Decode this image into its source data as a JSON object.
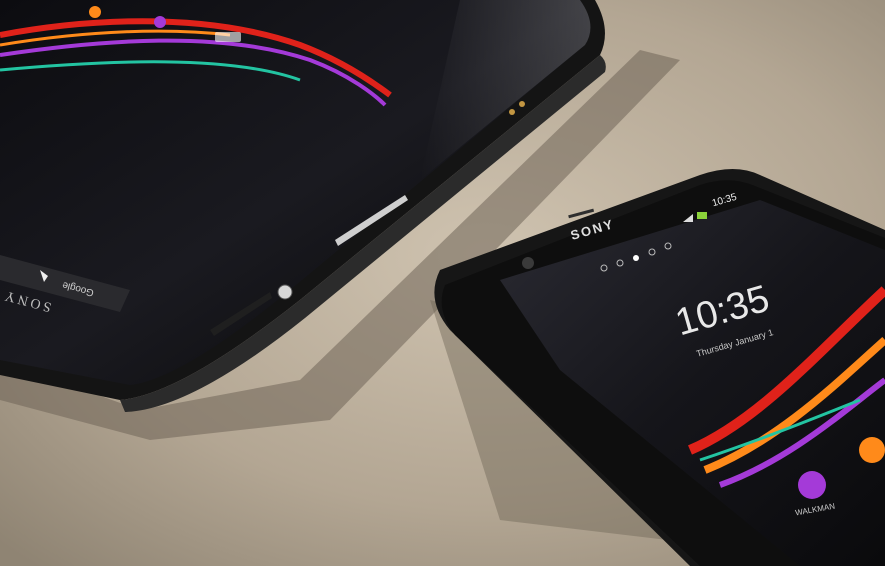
{
  "tablet": {
    "brand": "SONY",
    "search_label": "Google"
  },
  "phone": {
    "brand": "SONY",
    "status_time": "10:35",
    "lock_time": "10:35",
    "lock_date": "Thursday January 1",
    "page_dots": 5,
    "active_dot": 3,
    "app_label": "WALKMAN"
  },
  "colors": {
    "surface": "#b8ab98",
    "device_body": "#141414",
    "wave_red": "#e0221a",
    "wave_orange": "#ff8a1a",
    "wave_purple": "#a43ad8",
    "wave_teal": "#23c4a2"
  }
}
